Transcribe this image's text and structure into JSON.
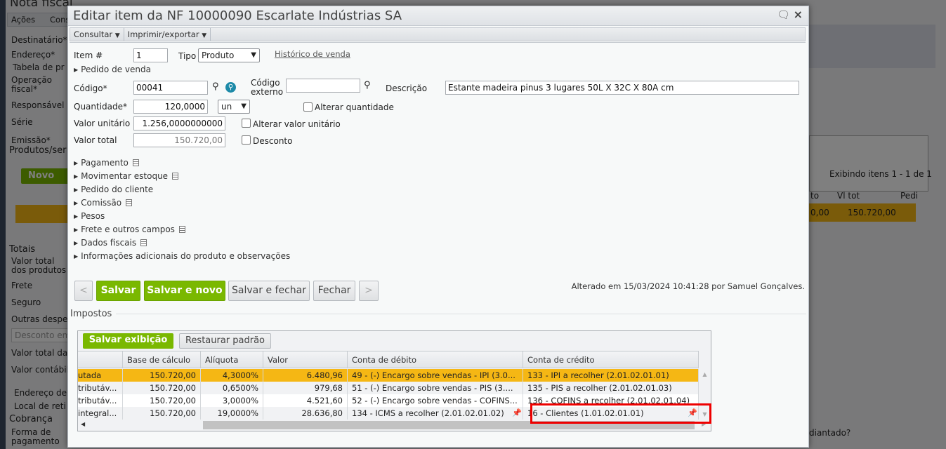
{
  "background": {
    "page_title": "Nota fiscal",
    "menu": [
      "Ações",
      "Cons"
    ],
    "labels": [
      "Destinatário*",
      "Endereço*",
      "Tabela de pr",
      "Operação fiscal*",
      "Responsável",
      "Série",
      "Emissão*"
    ],
    "products_section": "Produtos/ser",
    "new_button": "Novo",
    "totals_section": "Totais",
    "totals_labels": [
      "Valor total dos produtos e ser",
      "Frete",
      "Seguro",
      "Outras despesa",
      "Valor total da n",
      "Valor contábil"
    ],
    "discount_placeholder": "Desconto em",
    "collapsibles": [
      "Endereço de",
      "Local de reti"
    ],
    "billing_section": "Cobrança",
    "payment_label": "Forma de pagamento",
    "items_info": "Exibindo itens 1 - 1 de 1",
    "columns": [
      "to",
      "Vl tot",
      "Pedi"
    ],
    "row": [
      "0,00",
      "150.720,00"
    ],
    "advance_label": "diantado?"
  },
  "dialog": {
    "title": "Editar item da NF 10000090 Escarlate Indústrias SA",
    "toolbar": [
      "Consultar",
      "Imprimir/exportar"
    ],
    "form": {
      "item_label": "Item #",
      "item_value": "1",
      "tipo_label": "Tipo",
      "tipo_value": "Produto",
      "history_link": "Histórico de venda",
      "pedido_venda": "Pedido de venda",
      "codigo_label": "Código*",
      "codigo_value": "00041",
      "codigo_externo_label": "Código externo",
      "codigo_externo_value": "",
      "descricao_label": "Descrição",
      "descricao_value": "Estante madeira pinus 3 lugares 50L X 32C X 80A cm",
      "quantidade_label": "Quantidade*",
      "quantidade_value": "120,0000",
      "unit_value": "un",
      "alterar_quantidade": "Alterar quantidade",
      "valor_unitario_label": "Valor unitário",
      "valor_unitario_value": "1.256,0000000000",
      "alterar_valor_unitario": "Alterar valor unitário",
      "valor_total_label": "Valor total",
      "valor_total_value": "150.720,00",
      "desconto": "Desconto"
    },
    "sections": [
      "Pagamento",
      "Movimentar estoque",
      "Pedido do cliente",
      "Comissão",
      "Pesos",
      "Frete e outros campos",
      "Dados fiscais",
      "Informações adicionais do produto e observações"
    ],
    "buttons": {
      "prev": "<",
      "save": "Salvar",
      "save_new": "Salvar e novo",
      "save_close": "Salvar e fechar",
      "close": "Fechar",
      "next": ">"
    },
    "altered_text": "Alterado em 15/03/2024 10:41:28 por Samuel Gonçalves.",
    "taxes": {
      "title": "Impostos",
      "save_view": "Salvar exibição",
      "restore": "Restaurar padrão",
      "columns": [
        "",
        "Base de cálculo",
        "Alíquota",
        "Valor",
        "Conta de débito",
        "Conta de crédito"
      ],
      "rows": [
        [
          "utada",
          "150.720,00",
          "4,3000%",
          "6.480,96",
          "49 - (-) Encargo sobre vendas - IPI (3.0...",
          "133 - IPI a recolher (2.01.02.01.01)"
        ],
        [
          "tributáv...",
          "150.720,00",
          "0,6500%",
          "979,68",
          "51 - (-) Encargo sobre vendas - PIS (3....",
          "135 - PIS a recolher (2.01.02.01.03)"
        ],
        [
          "tributáv...",
          "150.720,00",
          "3,0000%",
          "4.521,60",
          "52 - (-) Encargo sobre vendas - COFINS...",
          "136 - COFINS a recolher (2.01.02.01.04)"
        ],
        [
          "integral...",
          "150.720,00",
          "19,0000%",
          "28.636,80",
          "134 - ICMS a recolher (2.01.02.01.02)",
          "16 - Clientes (1.01.02.01.01)"
        ]
      ],
      "selected_row_color": "#f5b714",
      "highlight_color": "#e00000"
    }
  }
}
